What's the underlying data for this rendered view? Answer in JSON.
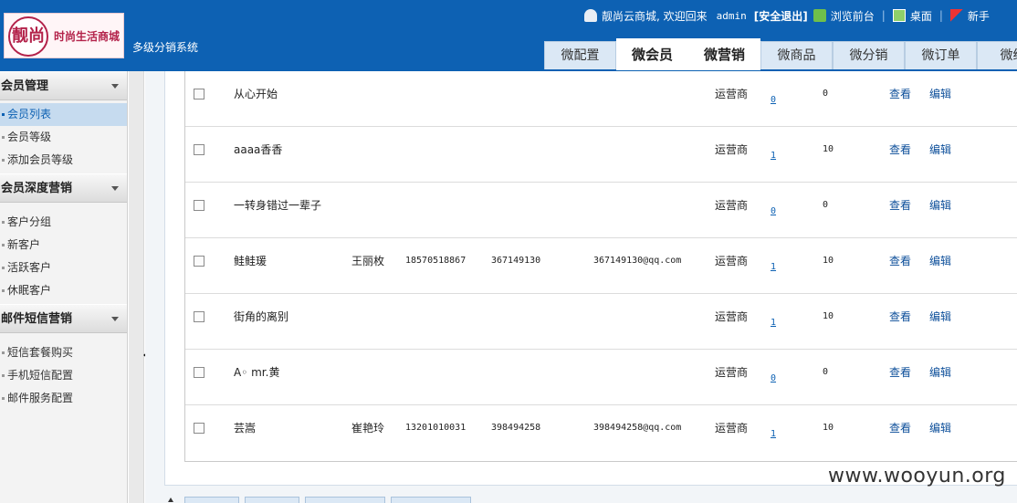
{
  "header": {
    "logo_mark": "靓尚",
    "logo_text": "时尚生活商城",
    "subtitle": "多级分销系统",
    "welcome": "靓尚云商城, 欢迎回来",
    "username": "admin",
    "logout": "[安全退出]",
    "browse_front": "浏览前台",
    "desktop": "桌面",
    "new_hand": "新手",
    "sep": "|",
    "tabs": [
      "微配置",
      "微会员",
      "微营销",
      "微商品",
      "微分销",
      "微订单",
      "微统"
    ]
  },
  "sidebar": {
    "groups": [
      {
        "title": "会员管理",
        "items": [
          "会员列表",
          "会员等级",
          "添加会员等级"
        ]
      },
      {
        "title": "会员深度营销",
        "items": [
          "客户分组",
          "新客户",
          "活跃客户",
          "休眠客户"
        ]
      },
      {
        "title": "邮件短信营销",
        "items": [
          "短信套餐购买",
          "手机短信配置",
          "邮件服务配置"
        ]
      }
    ]
  },
  "table": {
    "view_label": "查看",
    "edit_label": "编辑",
    "rows": [
      {
        "name": "从心开始",
        "real_name": "",
        "phone": "",
        "qq": "",
        "email": "",
        "role": "运营商",
        "count": "0",
        "num": "0"
      },
      {
        "name": "aaaa香香",
        "real_name": "",
        "phone": "",
        "qq": "",
        "email": "",
        "role": "运营商",
        "count": "1",
        "num": "10"
      },
      {
        "name": "一转身错过一辈子",
        "real_name": "",
        "phone": "",
        "qq": "",
        "email": "",
        "role": "运营商",
        "count": "0",
        "num": "0"
      },
      {
        "name": "鲑鲑瑗",
        "real_name": "王丽枚",
        "phone": "18570518867",
        "qq": "367149130",
        "email": "367149130@qq.com",
        "role": "运营商",
        "count": "1",
        "num": "10"
      },
      {
        "name": "街角的离别",
        "real_name": "",
        "phone": "",
        "qq": "",
        "email": "",
        "role": "运营商",
        "count": "1",
        "num": "10"
      },
      {
        "name": "A◦ mr.黄",
        "real_name": "",
        "phone": "",
        "qq": "",
        "email": "",
        "role": "运营商",
        "count": "0",
        "num": "0"
      },
      {
        "name": "芸嵩",
        "real_name": "崔艳玲",
        "phone": "13201010031",
        "qq": "398494258",
        "email": "398494258@qq.com",
        "role": "运营商",
        "count": "1",
        "num": "10"
      }
    ]
  },
  "watermark": "www.wooyun.org"
}
